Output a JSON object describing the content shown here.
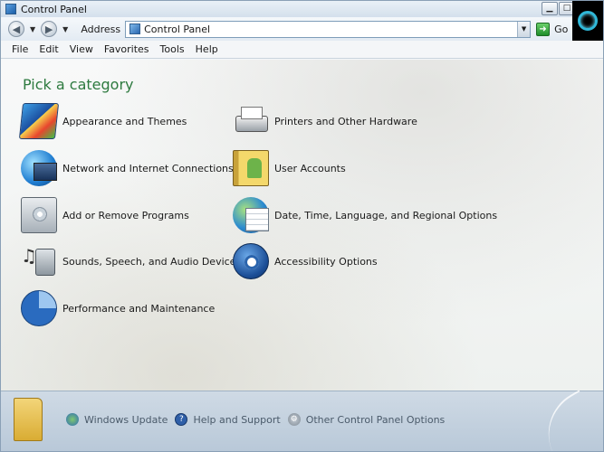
{
  "window": {
    "title": "Control Panel"
  },
  "addressbar": {
    "back_icon": "back-arrow-icon",
    "forward_icon": "forward-arrow-icon",
    "label": "Address",
    "value": "Control Panel",
    "go_label": "Go"
  },
  "menubar": {
    "items": [
      {
        "label": "File"
      },
      {
        "label": "Edit"
      },
      {
        "label": "View"
      },
      {
        "label": "Favorites"
      },
      {
        "label": "Tools"
      },
      {
        "label": "Help"
      }
    ]
  },
  "main": {
    "heading": "Pick a category",
    "categories": [
      {
        "label": "Appearance and Themes",
        "icon": "appearance-themes-icon"
      },
      {
        "label": "Printers and Other Hardware",
        "icon": "printer-icon"
      },
      {
        "label": "Network and Internet Connections",
        "icon": "network-globe-icon"
      },
      {
        "label": "User Accounts",
        "icon": "user-accounts-icon"
      },
      {
        "label": "Add or Remove Programs",
        "icon": "add-remove-programs-icon"
      },
      {
        "label": "Date, Time, Language, and Regional Options",
        "icon": "date-time-globe-icon"
      },
      {
        "label": "Sounds, Speech, and Audio Devices",
        "icon": "speaker-music-icon"
      },
      {
        "label": "Accessibility Options",
        "icon": "accessibility-icon"
      },
      {
        "label": "Performance and Maintenance",
        "icon": "performance-chart-icon"
      }
    ]
  },
  "taskpanel": {
    "items": [
      {
        "label": "Windows Update",
        "icon": "windows-update-icon"
      },
      {
        "label": "Help and Support",
        "icon": "help-icon"
      },
      {
        "label": "Other Control Panel Options",
        "icon": "gear-icon"
      }
    ]
  },
  "colors": {
    "heading": "#2d7a3f",
    "accent": "#2f5fa8"
  }
}
